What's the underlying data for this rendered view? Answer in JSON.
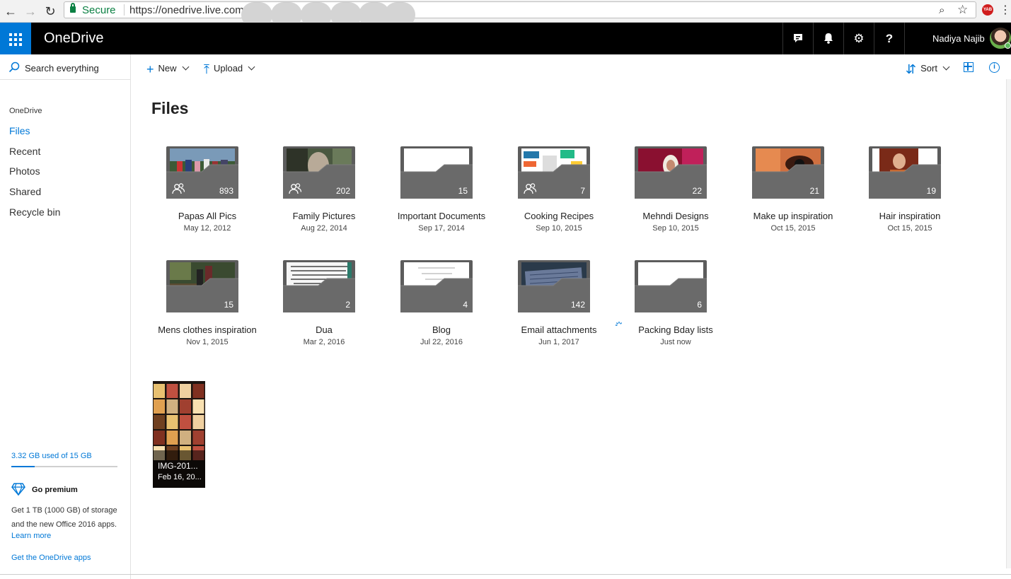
{
  "browser": {
    "back_glyph": "←",
    "forward_glyph": "→",
    "reload_glyph": "↻",
    "secure_label": "Secure",
    "url": "https://onedrive.live.com/",
    "zoom_glyph": "⌕",
    "star_glyph": "☆",
    "extension_label": "YAB",
    "menu_glyph": "⋮"
  },
  "suitebar": {
    "brand": "OneDrive",
    "chat_glyph": "■",
    "bell_glyph": "♪",
    "gear_glyph": "⚙",
    "help_glyph": "?",
    "user_name": "Nadiya Najib",
    "accent": "#0078d7"
  },
  "leftnav": {
    "search_placeholder": "Search everything",
    "root": "OneDrive",
    "items": [
      {
        "label": "Files",
        "active": true
      },
      {
        "label": "Recent",
        "active": false
      },
      {
        "label": "Photos",
        "active": false
      },
      {
        "label": "Shared",
        "active": false
      },
      {
        "label": "Recycle bin",
        "active": false
      }
    ],
    "quota_text": "3.32 GB used of 15 GB",
    "quota_fraction": 0.221,
    "premium_title": "Go premium",
    "premium_desc": "Get 1 TB (1000 GB) of storage and the new Office 2016 apps.",
    "learn_more": "Learn more",
    "get_apps": "Get the OneDrive apps"
  },
  "commandbar": {
    "new_label": "New",
    "new_glyph": "+",
    "upload_label": "Upload",
    "upload_glyph": "⤒",
    "sort_label": "Sort",
    "sort_glyph": "⇵",
    "info_glyph": "i"
  },
  "page_title": "Files",
  "folders": [
    {
      "name": "Papas All Pics",
      "date": "May 12, 2012",
      "count": "893",
      "shared": true,
      "preview": "photo-family"
    },
    {
      "name": "Family Pictures",
      "date": "Aug 22, 2014",
      "count": "202",
      "shared": true,
      "preview": "photo-portrait"
    },
    {
      "name": "Important Documents",
      "date": "Sep 17, 2014",
      "count": "15",
      "shared": false,
      "preview": "blank"
    },
    {
      "name": "Cooking Recipes",
      "date": "Sep 10, 2015",
      "count": "7",
      "shared": true,
      "preview": "infographic"
    },
    {
      "name": "Mehndi Designs",
      "date": "Sep 10, 2015",
      "count": "22",
      "shared": false,
      "preview": "photo-red"
    },
    {
      "name": "Make up inspiration",
      "date": "Oct 15, 2015",
      "count": "21",
      "shared": false,
      "preview": "photo-eye"
    },
    {
      "name": "Hair inspiration",
      "date": "Oct 15, 2015",
      "count": "19",
      "shared": false,
      "preview": "photo-hair"
    },
    {
      "name": "Mens clothes inspiration",
      "date": "Nov 1, 2015",
      "count": "15",
      "shared": false,
      "preview": "photo-outdoor"
    },
    {
      "name": "Dua",
      "date": "Mar 2, 2016",
      "count": "2",
      "shared": false,
      "preview": "document-arabic"
    },
    {
      "name": "Blog",
      "date": "Jul 22, 2016",
      "count": "4",
      "shared": false,
      "preview": "document"
    },
    {
      "name": "Email attachments",
      "date": "Jun 1, 2017",
      "count": "142",
      "shared": false,
      "preview": "photo-book"
    },
    {
      "name": "Packing Bday lists",
      "date": "Just now",
      "count": "6",
      "shared": false,
      "preview": "blank",
      "syncing": true
    }
  ],
  "files": [
    {
      "name": "IMG-201...",
      "date": "Feb 16, 20..."
    }
  ]
}
